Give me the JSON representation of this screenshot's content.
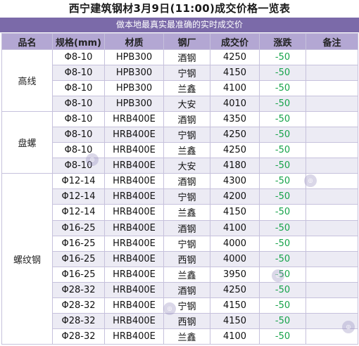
{
  "title": "西宁建筑钢材3月9日(11:00)成交价格一览表",
  "subtitle": "做本地最真实最准确的实时成交价",
  "headers": {
    "category": "品名",
    "spec": "规格(mm)",
    "material": "材质",
    "mill": "钢厂",
    "price": "成交价",
    "change": "涨跌",
    "note": "备注"
  },
  "groups": [
    {
      "name": "高线",
      "rows": [
        {
          "spec": "Φ8-10",
          "material": "HPB300",
          "mill": "酒钢",
          "price": "4250",
          "change": "-50",
          "note": ""
        },
        {
          "spec": "Φ8-10",
          "material": "HPB300",
          "mill": "宁钢",
          "price": "4150",
          "change": "-50",
          "note": ""
        },
        {
          "spec": "Φ8-10",
          "material": "HPB300",
          "mill": "兰鑫",
          "price": "4100",
          "change": "-50",
          "note": ""
        },
        {
          "spec": "Φ8-10",
          "material": "HPB300",
          "mill": "大安",
          "price": "4010",
          "change": "-50",
          "note": ""
        }
      ]
    },
    {
      "name": "盘螺",
      "rows": [
        {
          "spec": "Φ8-10",
          "material": "HRB400E",
          "mill": "酒钢",
          "price": "4350",
          "change": "-50",
          "note": ""
        },
        {
          "spec": "Φ8-10",
          "material": "HRB400E",
          "mill": "宁钢",
          "price": "4250",
          "change": "-50",
          "note": ""
        },
        {
          "spec": "Φ8-10",
          "material": "HRB400E",
          "mill": "兰鑫",
          "price": "4250",
          "change": "-50",
          "note": ""
        },
        {
          "spec": "Φ8-10",
          "material": "HRB400E",
          "mill": "大安",
          "price": "4180",
          "change": "-50",
          "note": ""
        }
      ]
    },
    {
      "name": "螺纹钢",
      "rows": [
        {
          "spec": "Φ12-14",
          "material": "HRB400E",
          "mill": "酒钢",
          "price": "4300",
          "change": "-50",
          "note": ""
        },
        {
          "spec": "Φ12-14",
          "material": "HRB400E",
          "mill": "宁钢",
          "price": "4200",
          "change": "-50",
          "note": ""
        },
        {
          "spec": "Φ12-14",
          "material": "HRB400E",
          "mill": "兰鑫",
          "price": "4150",
          "change": "-50",
          "note": ""
        },
        {
          "spec": "Φ16-25",
          "material": "HRB400E",
          "mill": "酒钢",
          "price": "4100",
          "change": "-50",
          "note": ""
        },
        {
          "spec": "Φ16-25",
          "material": "HRB400E",
          "mill": "宁钢",
          "price": "4000",
          "change": "-50",
          "note": ""
        },
        {
          "spec": "Φ16-25",
          "material": "HRB400E",
          "mill": "西钢",
          "price": "4000",
          "change": "-50",
          "note": ""
        },
        {
          "spec": "Φ16-25",
          "material": "HRB400E",
          "mill": "兰鑫",
          "price": "3950",
          "change": "-50",
          "note": ""
        },
        {
          "spec": "Φ28-32",
          "material": "HRB400E",
          "mill": "酒钢",
          "price": "4250",
          "change": "-50",
          "note": ""
        },
        {
          "spec": "Φ28-32",
          "material": "HRB400E",
          "mill": "宁钢",
          "price": "4150",
          "change": "-50",
          "note": ""
        },
        {
          "spec": "Φ28-32",
          "material": "HRB400E",
          "mill": "西钢",
          "price": "4150",
          "change": "-50",
          "note": ""
        },
        {
          "spec": "Φ28-32",
          "material": "HRB400E",
          "mill": "兰鑫",
          "price": "4100",
          "change": "-50",
          "note": ""
        }
      ]
    }
  ],
  "colors": {
    "header_bg": "#b3a7d3",
    "subtitle_bg": "#7b6aa9",
    "alt_row_bg": "#ecebf4",
    "change_color": "#16a34a"
  },
  "watermark_icon": "watermark-logo"
}
